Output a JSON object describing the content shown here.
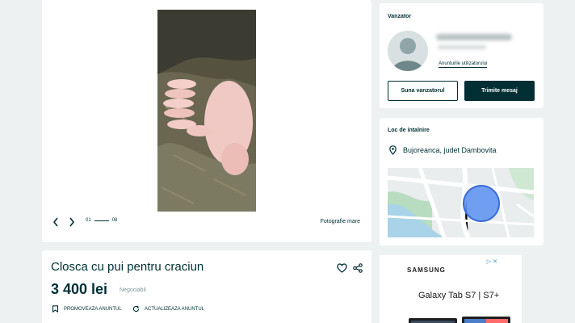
{
  "gallery": {
    "pager_current": "01",
    "pager_total": "08",
    "big_photo_label": "Fotografie mare"
  },
  "seller": {
    "section_title": "Vanzator",
    "user_ads_link": "Anunturile utilizatorului",
    "call_button": "Suna vanzatorul",
    "message_button": "Trimite mesaj"
  },
  "location": {
    "section_title": "Loc de intalnire",
    "place": "Bujoreanca, judet Dambovita"
  },
  "listing": {
    "title": "Closca cu pui pentru craciun",
    "price": "3 400 lei",
    "negotiable": "Negociabil",
    "promote_label": "PROMOVEAZA ANUNTUL",
    "refresh_label": "ACTUALIZEAZA ANUNTUL"
  },
  "ad": {
    "brand": "SAMSUNG",
    "product": "Galaxy Tab S7 | S7+",
    "marker": "▷ ✕"
  },
  "colors": {
    "primary": "#002f34",
    "background": "#eef1f2",
    "muted": "#7f9799",
    "map_circle": "#5b8ff0"
  },
  "icons": [
    "chevron-left-icon",
    "chevron-right-icon",
    "heart-icon",
    "share-icon",
    "star-icon",
    "refresh-icon",
    "location-pin-icon"
  ]
}
